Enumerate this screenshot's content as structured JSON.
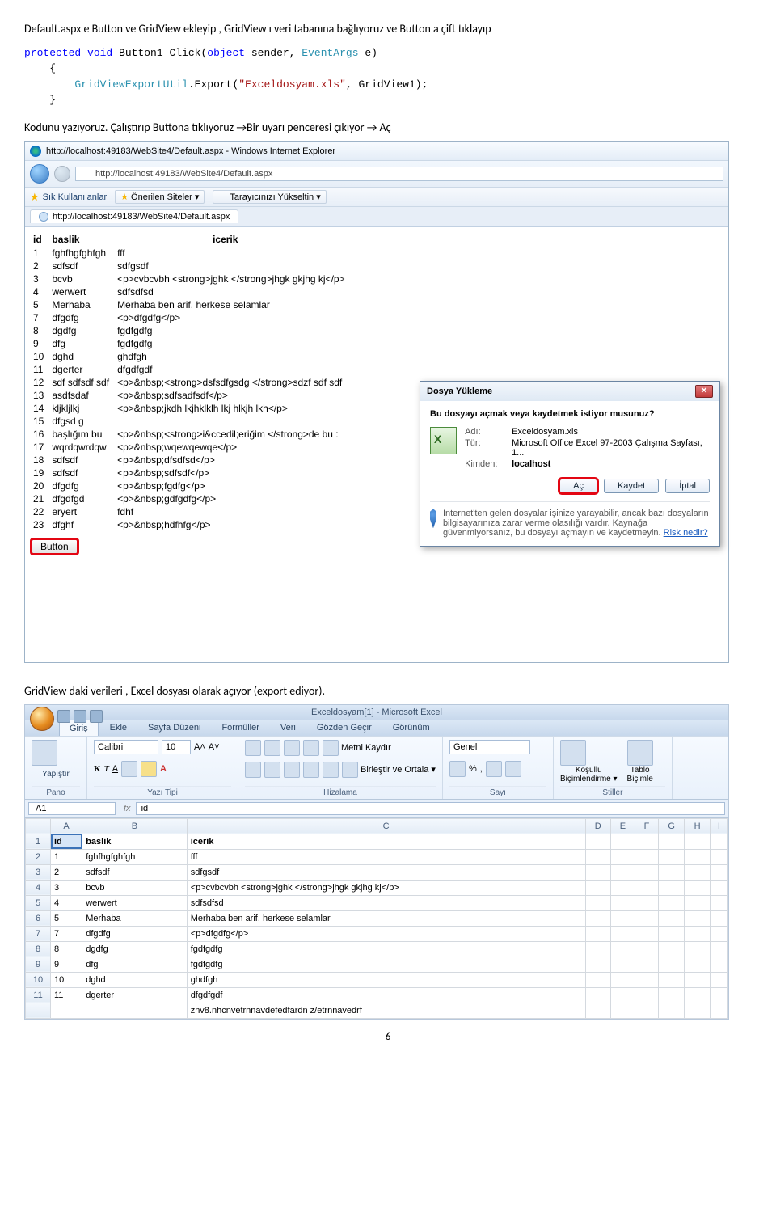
{
  "para1": "Default.aspx e Button ve GridView ekleyip , GridView ı veri tabanına bağlıyoruz ve Button a çift tıklayıp",
  "code": {
    "l1a": "protected",
    "l1b": " void",
    "l1c": " Button1_Click(",
    "l1d": "object",
    "l1e": " sender, ",
    "l1f": "EventArgs",
    "l1g": " e)",
    "l2": "    {",
    "l3a": "        ",
    "l3b": "GridViewExportUtil",
    "l3c": ".Export(",
    "l3d": "\"Exceldosyam.xls\"",
    "l3e": ", GridView1);",
    "l4": "    }"
  },
  "para2": "Kodunu yazıyoruz. Çalıştırıp Buttona tıklıyoruz →Bir uyarı penceresi çıkıyor → Aç",
  "browser": {
    "titlebar": "http://localhost:49183/WebSite4/Default.aspx - Windows Internet Explorer",
    "url": "http://localhost:49183/WebSite4/Default.aspx",
    "fav_label": "Sık Kullanılanlar",
    "suggested": "Önerilen Siteler ▾",
    "upgrade": "Tarayıcınızı Yükseltin ▾",
    "tab": "http://localhost:49183/WebSite4/Default.aspx",
    "headers": [
      "id",
      "baslik",
      "icerik"
    ],
    "rows": [
      [
        "1",
        "fghfhgfghfgh",
        "fff"
      ],
      [
        "2",
        "sdfsdf",
        "sdfgsdf"
      ],
      [
        "3",
        "bcvb",
        "<p>cvbcvbh <strong>jghk </strong>jhgk gkjhg kj</p>"
      ],
      [
        "4",
        "werwert",
        "sdfsdfsd"
      ],
      [
        "5",
        "Merhaba",
        "Merhaba ben arif. herkese selamlar"
      ],
      [
        "7",
        "dfgdfg",
        "<p>dfgdfg</p>"
      ],
      [
        "8",
        "dgdfg",
        "fgdfgdfg"
      ],
      [
        "9",
        "dfg",
        "fgdfgdfg"
      ],
      [
        "10",
        "dghd",
        "ghdfgh"
      ],
      [
        "11",
        "dgerter",
        "dfgdfgdf"
      ],
      [
        "12",
        "sdf sdfsdf sdf",
        "<p>&nbsp;<strong>dsfsdfgsdg </strong>sdzf sdf sdf"
      ],
      [
        "13",
        "asdfsdaf",
        "<p>&nbsp;sdfsadfsdf</p>"
      ],
      [
        "14",
        "kljkljlkj",
        "<p>&nbsp;jkdh lkjhklklh lkj hlkjh lkh</p>"
      ],
      [
        "15",
        "dfgsd g",
        ""
      ],
      [
        "16",
        "başlığım bu",
        "<p>&nbsp;<strong>i&ccedil;eriğim </strong>de bu :"
      ],
      [
        "17",
        "wqrdqwrdqw",
        "<p>&nbsp;wqewqewqe</p>"
      ],
      [
        "18",
        "sdfsdf",
        "<p>&nbsp;dfsdfsd</p>"
      ],
      [
        "19",
        "sdfsdf",
        "<p>&nbsp;sdfsdf</p>"
      ],
      [
        "20",
        "dfgdfg",
        "<p>&nbsp;fgdfg</p>"
      ],
      [
        "21",
        "dfgdfgd",
        "<p>&nbsp;gdfgdfg</p>"
      ],
      [
        "22",
        "eryert",
        "fdhf"
      ],
      [
        "23",
        "dfghf",
        "<p>&nbsp;hdfhfg</p>"
      ]
    ],
    "button_label": "Button"
  },
  "dialog": {
    "title": "Dosya Yükleme",
    "question": "Bu dosyayı açmak veya kaydetmek istiyor musunuz?",
    "k_name": "Adı:",
    "v_name": "Exceldosyam.xls",
    "k_type": "Tür:",
    "v_type": "Microsoft Office Excel 97-2003 Çalışma Sayfası, 1...",
    "k_from": "Kimden:",
    "v_from": "localhost",
    "btn_open": "Aç",
    "btn_save": "Kaydet",
    "btn_cancel": "İptal",
    "note": "Internet'ten gelen dosyalar işinize yarayabilir, ancak bazı dosyaların bilgisayarınıza zarar verme olasılığı vardır. Kaynağa güvenmiyorsanız, bu dosyayı açmayın ve kaydetmeyin. ",
    "risk": "Risk nedir?"
  },
  "para3": "GridView daki verileri , Excel dosyası olarak açıyor (export ediyor).",
  "excel": {
    "title": "Exceldosyam[1] - Microsoft Excel",
    "tabs": [
      "Giriş",
      "Ekle",
      "Sayfa Düzeni",
      "Formüller",
      "Veri",
      "Gözden Geçir",
      "Görünüm"
    ],
    "grp_pano": "Pano",
    "paste": "Yapıştır",
    "font": "Calibri",
    "size": "10",
    "grp_font": "Yazı Tipi",
    "wrap": "Metni Kaydır",
    "merge": "Birleştir ve Ortala ▾",
    "grp_align": "Hizalama",
    "numfmt": "Genel",
    "grp_num": "Sayı",
    "cond": "Koşullu",
    "cond2": "Biçimlendirme ▾",
    "tbl": "Tablo",
    "tbl2": "Biçimle",
    "grp_styles": "Stiller",
    "namebox": "A1",
    "fx": "fx",
    "fxval": "id",
    "cols": [
      "",
      "A",
      "B",
      "C",
      "D",
      "E",
      "F",
      "G",
      "H",
      "I"
    ],
    "rows": [
      [
        "1",
        "id",
        "baslik",
        "icerik",
        "",
        "",
        "",
        "",
        "",
        ""
      ],
      [
        "2",
        "1",
        "fghfhgfghfgh",
        "fff",
        "",
        "",
        "",
        "",
        "",
        ""
      ],
      [
        "3",
        "2",
        "sdfsdf",
        "sdfgsdf",
        "",
        "",
        "",
        "",
        "",
        ""
      ],
      [
        "4",
        "3",
        "bcvb",
        "<p>cvbcvbh <strong>jghk </strong>jhgk gkjhg kj</p>",
        "",
        "",
        "",
        "",
        "",
        ""
      ],
      [
        "5",
        "4",
        "werwert",
        "sdfsdfsd",
        "",
        "",
        "",
        "",
        "",
        ""
      ],
      [
        "6",
        "5",
        "Merhaba",
        "Merhaba ben arif. herkese selamlar",
        "",
        "",
        "",
        "",
        "",
        ""
      ],
      [
        "7",
        "7",
        "dfgdfg",
        "<p>dfgdfg</p>",
        "",
        "",
        "",
        "",
        "",
        ""
      ],
      [
        "8",
        "8",
        "dgdfg",
        "fgdfgdfg",
        "",
        "",
        "",
        "",
        "",
        ""
      ],
      [
        "9",
        "9",
        "dfg",
        "fgdfgdfg",
        "",
        "",
        "",
        "",
        "",
        ""
      ],
      [
        "10",
        "10",
        "dghd",
        "ghdfgh",
        "",
        "",
        "",
        "",
        "",
        ""
      ],
      [
        "11",
        "11",
        "dgerter",
        "dfgdfgdf",
        "",
        "",
        "",
        "",
        "",
        ""
      ]
    ],
    "lastrow": "znv8.nhcnvetrnnavdefedfardn z/etrnnavedrf"
  },
  "page_number": "6"
}
